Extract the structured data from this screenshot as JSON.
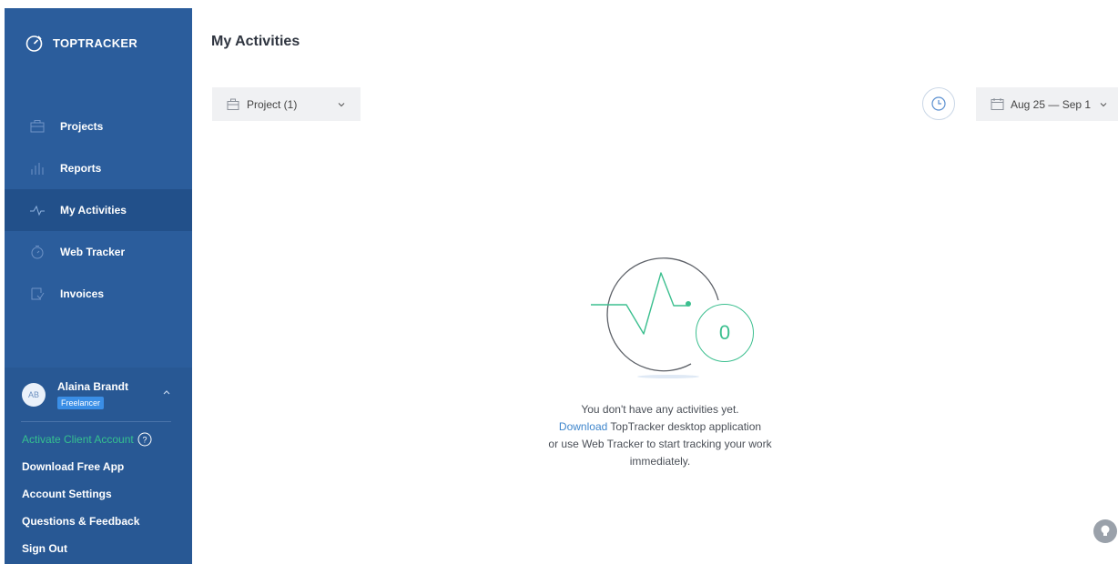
{
  "app": {
    "name": "TOPTRACKER",
    "icon": "stopwatch-icon"
  },
  "sidebar": {
    "items": [
      {
        "label": "Projects",
        "icon": "briefcase-icon"
      },
      {
        "label": "Reports",
        "icon": "bar-chart-icon"
      },
      {
        "label": "My Activities",
        "icon": "pulse-icon",
        "active": true
      },
      {
        "label": "Web Tracker",
        "icon": "stopwatch-icon"
      },
      {
        "label": "Invoices",
        "icon": "invoice-icon"
      }
    ],
    "user": {
      "initials": "AB",
      "name": "Alaina Brandt",
      "role": "Freelancer"
    },
    "menu": {
      "activate_client": "Activate Client Account",
      "download_app": "Download Free App",
      "account_settings": "Account Settings",
      "questions_feedback": "Questions & Feedback",
      "sign_out": "Sign Out"
    }
  },
  "main": {
    "title": "My Activities",
    "project_filter": "Project (1)",
    "date_range": "Aug 25 — Sep 1",
    "activity_count": "0",
    "empty_state": {
      "line1": "You don't have any activities yet.",
      "download_link": "Download",
      "line2_rest": " TopTracker desktop application",
      "line3": "or use Web Tracker to start tracking your work",
      "line4": "immediately."
    }
  },
  "colors": {
    "sidebar": "#2b5d9c",
    "sidebar_active": "#22508a",
    "accent_green": "#3cbf8f",
    "link_blue": "#3f86cc",
    "badge_blue": "#3a8ee6"
  }
}
